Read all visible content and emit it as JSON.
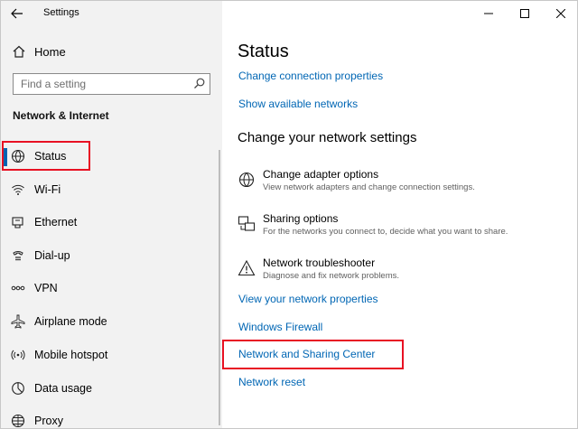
{
  "window": {
    "app_title": "Settings",
    "controls": {
      "minimize": "—",
      "maximize": "☐",
      "close": "✕"
    }
  },
  "sidebar": {
    "home_label": "Home",
    "search_placeholder": "Find a setting",
    "section_title": "Network & Internet",
    "items": [
      {
        "label": "Status",
        "icon": "globe-icon",
        "active": true
      },
      {
        "label": "Wi-Fi",
        "icon": "wifi-icon"
      },
      {
        "label": "Ethernet",
        "icon": "ethernet-icon"
      },
      {
        "label": "Dial-up",
        "icon": "dialup-icon"
      },
      {
        "label": "VPN",
        "icon": "vpn-icon"
      },
      {
        "label": "Airplane mode",
        "icon": "airplane-icon"
      },
      {
        "label": "Mobile hotspot",
        "icon": "hotspot-icon"
      },
      {
        "label": "Data usage",
        "icon": "data-usage-icon"
      },
      {
        "label": "Proxy",
        "icon": "proxy-globe-icon"
      }
    ]
  },
  "main": {
    "title": "Status",
    "links_top": [
      "Change connection properties",
      "Show available networks"
    ],
    "section_title": "Change your network settings",
    "options": [
      {
        "title": "Change adapter options",
        "desc": "View network adapters and change connection settings.",
        "icon": "adapter-icon"
      },
      {
        "title": "Sharing options",
        "desc": "For the networks you connect to, decide what you want to share.",
        "icon": "sharing-icon"
      },
      {
        "title": "Network troubleshooter",
        "desc": "Diagnose and fix network problems.",
        "icon": "warning-icon"
      }
    ],
    "links_bottom": [
      "View your network properties",
      "Windows Firewall",
      "Network and Sharing Center",
      "Network reset"
    ]
  },
  "colors": {
    "accent": "#0063b1",
    "link": "#0066b4",
    "highlight": "#e81123",
    "sidebar_bg": "#f2f2f2"
  }
}
